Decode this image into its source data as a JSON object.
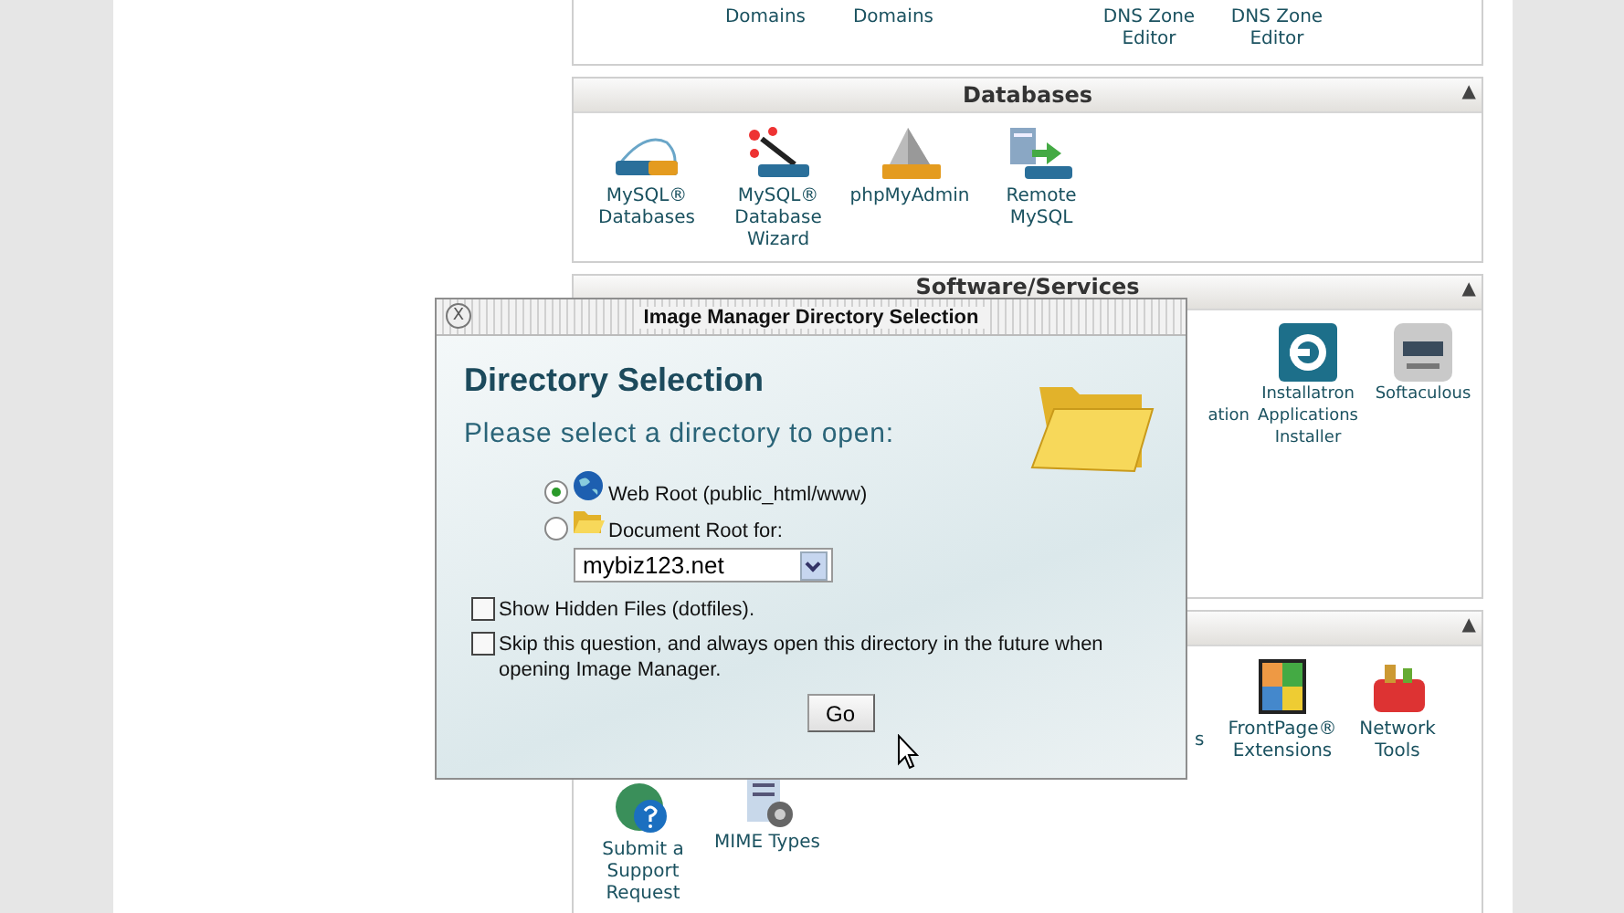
{
  "top_panel": {
    "items": [
      {
        "label": "Domains"
      },
      {
        "label": "Domains"
      },
      {
        "label": "DNS Zone Editor"
      },
      {
        "label": "DNS Zone Editor"
      }
    ]
  },
  "panels": [
    {
      "title": "Databases",
      "collapse_glyph": "▲",
      "items": [
        {
          "kind": "app",
          "label": "MySQL® Databases"
        },
        {
          "kind": "app",
          "label": "MySQL® Database Wizard"
        },
        {
          "kind": "app",
          "label": "phpMyAdmin"
        },
        {
          "kind": "app",
          "label": "Remote MySQL"
        }
      ]
    },
    {
      "title": "Software/Services",
      "collapse_glyph": "▲",
      "items": [
        {
          "kind": "fragment",
          "label": "ation"
        },
        {
          "kind": "app",
          "label": "Installatron Applications Installer"
        },
        {
          "kind": "app",
          "label": "Softaculous"
        }
      ]
    },
    {
      "collapse_glyph": "▲",
      "items": [
        {
          "kind": "fragment",
          "label": "s"
        },
        {
          "kind": "app",
          "label": "FrontPage® Extensions"
        },
        {
          "kind": "app",
          "label": "Network Tools"
        },
        {
          "kind": "break"
        },
        {
          "kind": "app",
          "label": "Submit a Support Request"
        },
        {
          "kind": "app",
          "label": "MIME Types"
        }
      ]
    }
  ],
  "dialog": {
    "title": "Image Manager Directory Selection",
    "close_glyph": "X",
    "heading": "Directory Selection",
    "prompt": "Please select a directory to open:",
    "options": [
      {
        "label": "Web Root (public_html/www)",
        "selected": true
      },
      {
        "label": "Document Root for:",
        "selected": false
      }
    ],
    "domain_select": {
      "value": "mybiz123.net"
    },
    "checkboxes": [
      {
        "label": "Show Hidden Files (dotfiles).",
        "checked": false
      },
      {
        "label": "Skip this question, and always open this directory in the future when opening Image Manager.",
        "checked": false
      }
    ],
    "button": "Go"
  }
}
